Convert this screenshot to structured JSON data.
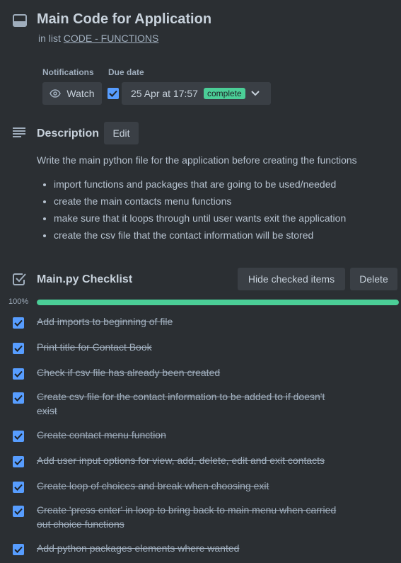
{
  "card": {
    "title": "Main Code for Application",
    "in_list_prefix": "in list",
    "list_name": "CODE - FUNCTIONS"
  },
  "meta": {
    "notifications_label": "Notifications",
    "due_date_label": "Due date",
    "watch_label": "Watch",
    "due_date_value": "25 Apr at 17:57",
    "due_status": "complete"
  },
  "description": {
    "heading": "Description",
    "edit_label": "Edit",
    "text": "Write the main python file for the application before creating the functions",
    "bullets": [
      "import functions and packages that are going to be used/needed",
      "create the main contacts menu functions",
      "make sure that it loops through until user wants exit the application",
      "create the csv file that the contact information will be stored"
    ]
  },
  "checklist": {
    "heading": "Main.py Checklist",
    "hide_checked_label": "Hide checked items",
    "delete_label": "Delete",
    "progress_label": "100%",
    "progress_fraction": 1.0,
    "items": [
      {
        "text": "Add imports to beginning of file",
        "checked": true
      },
      {
        "text": "Print title for Contact Book",
        "checked": true
      },
      {
        "text": "Check if csv file has already been created",
        "checked": true
      },
      {
        "text": "Create csv file for the contact information to be added to if doesn't exist",
        "checked": true
      },
      {
        "text": "Create contact menu function",
        "checked": true
      },
      {
        "text": "Add user input options for view, add, delete, edit and exit contacts",
        "checked": true
      },
      {
        "text": "Create loop of choices and break when choosing exit",
        "checked": true
      },
      {
        "text": "Create 'press enter' in loop to bring back to main menu when carried out choice functions",
        "checked": true
      },
      {
        "text": "Add python packages elements where wanted",
        "checked": true
      }
    ]
  },
  "colors": {
    "background": "#2b2f33",
    "accent": "#579dff",
    "success": "#4bce97",
    "button_bg": "#3a3f45"
  }
}
